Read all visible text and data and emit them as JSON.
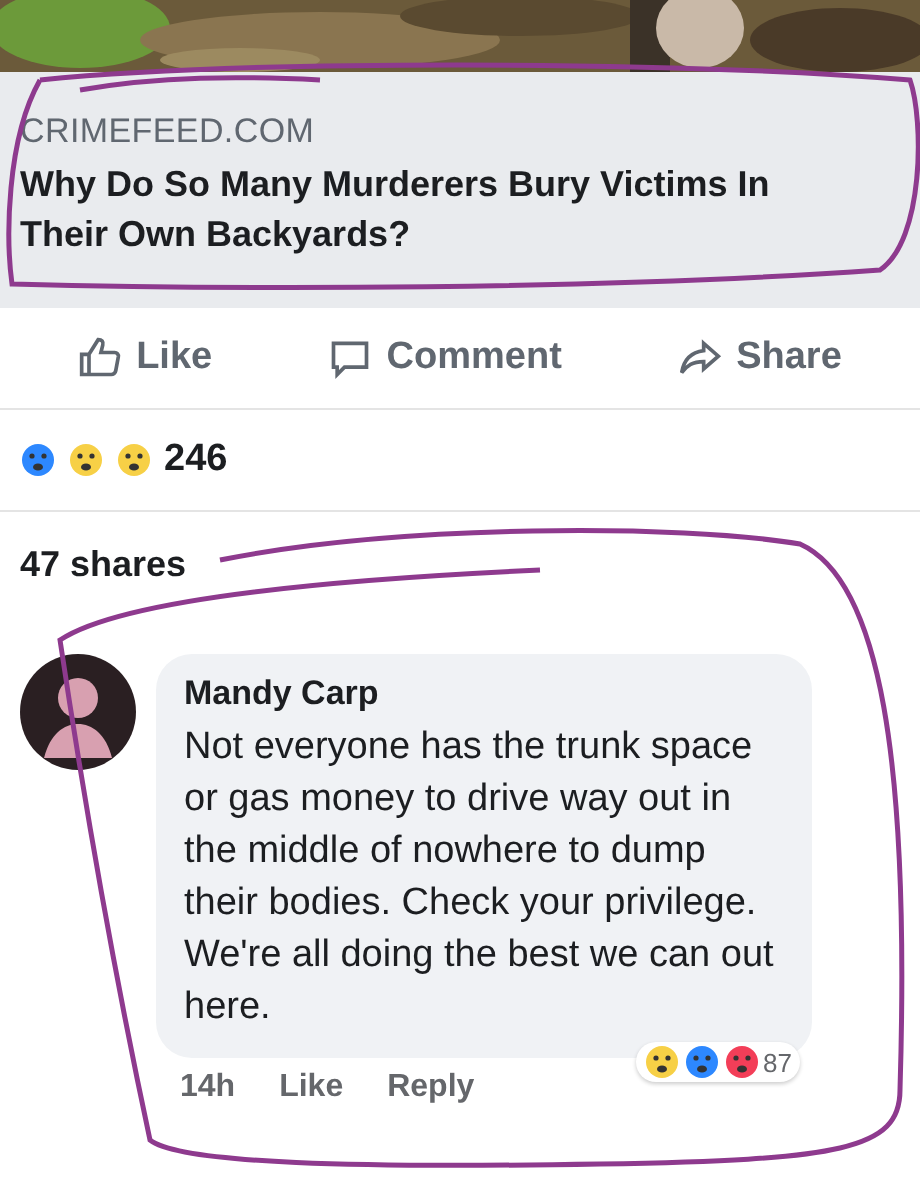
{
  "link_preview": {
    "domain": "CRIMEFEED.COM",
    "title": "Why Do So Many Murderers Bury Victims In Their Own Backyards?"
  },
  "actions": [
    {
      "kind": "like",
      "label": "Like"
    },
    {
      "kind": "comment",
      "label": "Comment"
    },
    {
      "kind": "share",
      "label": "Share"
    }
  ],
  "reactions": {
    "count": "246"
  },
  "shares": "47 shares",
  "comment": {
    "author": "Mandy Carp",
    "text": "Not everyone has the trunk space or gas money to drive way out in the middle of nowhere to dump their bodies. Check your privilege. We're all doing the best we can out here.",
    "time": "14h",
    "actions": [
      "Like",
      "Reply"
    ],
    "reaction_count": "87"
  }
}
